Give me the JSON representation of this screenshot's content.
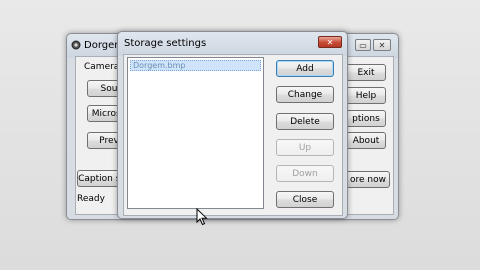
{
  "main_window": {
    "title": "Dorgem",
    "labels": {
      "camera_settings": "Camera s",
      "status": "Ready"
    },
    "buttons": {
      "source": "Sou",
      "microsoft": "Microso",
      "preview": "Prev",
      "caption": "Caption se",
      "exit": "Exit",
      "help": "Help",
      "options": "ptions",
      "about": "About",
      "store_now": "ore now"
    },
    "title_controls": [
      "restore-icon",
      "close-icon"
    ]
  },
  "dialog": {
    "title": "Storage settings",
    "list": {
      "items": [
        "Dorgem.bmp"
      ],
      "selected_index": 0
    },
    "buttons": {
      "add": "Add",
      "change": "Change",
      "delete": "Delete",
      "up": "Up",
      "down": "Down",
      "close": "Close"
    }
  },
  "colors": {
    "selection": "#cfe4fa",
    "close_button": "#c74a35",
    "default_border": "#3c7fb1"
  }
}
